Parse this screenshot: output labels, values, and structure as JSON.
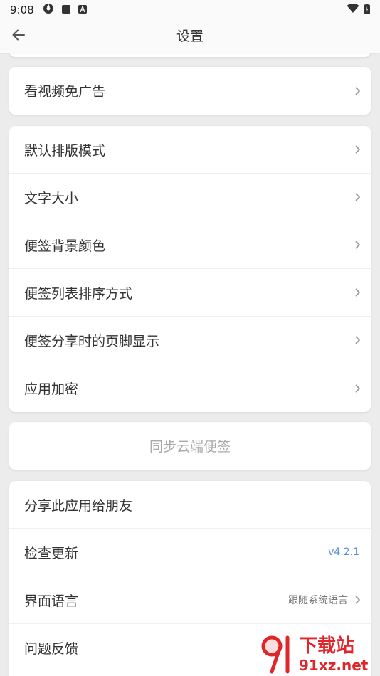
{
  "status_bar": {
    "time": "9:08"
  },
  "app_bar": {
    "title": "设置"
  },
  "group_ads": {
    "label": "看视频免广告"
  },
  "group_display": {
    "items": [
      {
        "label": "默认排版模式"
      },
      {
        "label": "文字大小"
      },
      {
        "label": "便签背景颜色"
      },
      {
        "label": "便签列表排序方式"
      },
      {
        "label": "便签分享时的页脚显示"
      },
      {
        "label": "应用加密"
      }
    ]
  },
  "sync": {
    "label": "同步云端便签"
  },
  "group_about": {
    "share": {
      "label": "分享此应用给朋友"
    },
    "update": {
      "label": "检查更新",
      "value": "v4.2.1"
    },
    "language": {
      "label": "界面语言",
      "value": "跟随系统语言"
    },
    "feedback": {
      "label": "问题反馈"
    }
  },
  "watermark": {
    "text_top": "下载站",
    "text_bottom": "91xz.net"
  },
  "colors": {
    "accent_version": "#5b8fd6",
    "background": "#ececec",
    "card": "#ffffff",
    "watermark_red": "#e0262b"
  }
}
